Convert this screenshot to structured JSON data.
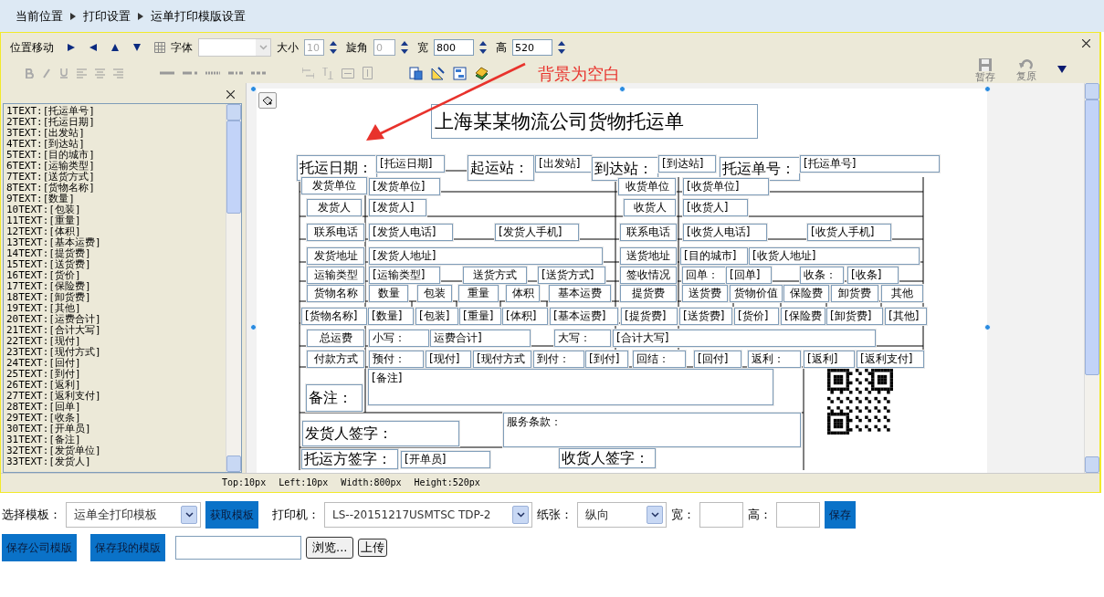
{
  "breadcrumb": [
    "当前位置",
    "打印设置",
    "运单打印模版设置"
  ],
  "toolbar": {
    "move_label": "位置移动",
    "font_label": "字体",
    "size_label": "大小",
    "size_value": "10",
    "size_disabled": true,
    "rotate_label": "旋角",
    "rotate_value": "0",
    "rotate_disabled": true,
    "width_label": "宽",
    "width_value": "800",
    "height_label": "高",
    "height_value": "520",
    "save_draft": "暂存",
    "restore": "复原",
    "actions_disabled": true
  },
  "annotation": "背景为空白",
  "field_list": [
    "1TEXT:[托运单号]",
    "2TEXT:[托运日期]",
    "3TEXT:[出发站]",
    "4TEXT:[到达站]",
    "5TEXT:[目的城市]",
    "6TEXT:[运输类型]",
    "7TEXT:[送货方式]",
    "8TEXT:[货物名称]",
    "9TEXT:[数量]",
    "10TEXT:[包装]",
    "11TEXT:[重量]",
    "12TEXT:[体积]",
    "13TEXT:[基本运费]",
    "14TEXT:[提货费]",
    "15TEXT:[送货费]",
    "16TEXT:[货价]",
    "17TEXT:[保险费]",
    "18TEXT:[卸货费]",
    "19TEXT:[其他]",
    "20TEXT:[运费合计]",
    "21TEXT:[合计大写]",
    "22TEXT:[现付]",
    "23TEXT:[现付方式]",
    "24TEXT:[回付]",
    "25TEXT:[到付]",
    "26TEXT:[返利]",
    "27TEXT:[返利支付]",
    "28TEXT:[回单]",
    "29TEXT:[收条]",
    "30TEXT:[开单员]",
    "31TEXT:[备注]",
    "32TEXT:[发货单位]",
    "33TEXT:[发货人]"
  ],
  "canvas": {
    "title": "上海某某物流公司货物托运单",
    "fields": [
      {
        "text": "托运日期：",
        "kind": "heading"
      },
      {
        "text": "[托运日期]",
        "kind": "value"
      },
      {
        "text": "起运站：",
        "kind": "heading"
      },
      {
        "text": "[出发站]",
        "kind": "value"
      },
      {
        "text": "到达站：",
        "kind": "heading"
      },
      {
        "text": "[到达站]",
        "kind": "value"
      },
      {
        "text": "托运单号：",
        "kind": "heading"
      },
      {
        "text": "[托运单号]",
        "kind": "value"
      },
      {
        "text": "发货单位",
        "kind": "label"
      },
      {
        "text": "[发货单位]",
        "kind": "value"
      },
      {
        "text": "收货单位",
        "kind": "label"
      },
      {
        "text": "[收货单位]",
        "kind": "value"
      },
      {
        "text": "发货人",
        "kind": "label"
      },
      {
        "text": "[发货人]",
        "kind": "value"
      },
      {
        "text": "收货人",
        "kind": "label"
      },
      {
        "text": "[收货人]",
        "kind": "value"
      },
      {
        "text": "联系电话",
        "kind": "label"
      },
      {
        "text": "[发货人电话]",
        "kind": "value"
      },
      {
        "text": "[发货人手机]",
        "kind": "value"
      },
      {
        "text": "联系电话",
        "kind": "label"
      },
      {
        "text": "[收货人电话]",
        "kind": "value"
      },
      {
        "text": "[收货人手机]",
        "kind": "value"
      },
      {
        "text": "发货地址",
        "kind": "label"
      },
      {
        "text": "[发货人地址]",
        "kind": "value"
      },
      {
        "text": "送货地址",
        "kind": "label"
      },
      {
        "text": "[目的城市]",
        "kind": "value"
      },
      {
        "text": "[收货人地址]",
        "kind": "value"
      },
      {
        "text": "运输类型",
        "kind": "label"
      },
      {
        "text": "[运输类型]",
        "kind": "value"
      },
      {
        "text": "送货方式",
        "kind": "label"
      },
      {
        "text": "[送货方式]",
        "kind": "value"
      },
      {
        "text": "签收情况",
        "kind": "label"
      },
      {
        "text": "回单：",
        "kind": "value"
      },
      {
        "text": "[回单]",
        "kind": "value"
      },
      {
        "text": "收条：",
        "kind": "value"
      },
      {
        "text": "[收条]",
        "kind": "value"
      },
      {
        "text": "货物名称",
        "kind": "label"
      },
      {
        "text": "数量",
        "kind": "label"
      },
      {
        "text": "包装",
        "kind": "label"
      },
      {
        "text": "重量",
        "kind": "label"
      },
      {
        "text": "体积",
        "kind": "label"
      },
      {
        "text": "基本运费",
        "kind": "label"
      },
      {
        "text": "提货费",
        "kind": "label"
      },
      {
        "text": "送货费",
        "kind": "label"
      },
      {
        "text": "货物价值",
        "kind": "label"
      },
      {
        "text": "保险费",
        "kind": "label"
      },
      {
        "text": "卸货费",
        "kind": "label"
      },
      {
        "text": "其他",
        "kind": "label"
      },
      {
        "text": "[货物名称]",
        "kind": "value"
      },
      {
        "text": "[数量]",
        "kind": "value"
      },
      {
        "text": "[包装]",
        "kind": "value"
      },
      {
        "text": "[重量]",
        "kind": "value"
      },
      {
        "text": "[体积]",
        "kind": "value"
      },
      {
        "text": "[基本运费]",
        "kind": "value"
      },
      {
        "text": "[提货费]",
        "kind": "value"
      },
      {
        "text": "[送货费]",
        "kind": "value"
      },
      {
        "text": "[货价]",
        "kind": "value"
      },
      {
        "text": "[保险费",
        "kind": "value"
      },
      {
        "text": "[卸货费]",
        "kind": "value"
      },
      {
        "text": "[其他]",
        "kind": "value"
      },
      {
        "text": "总运费",
        "kind": "label"
      },
      {
        "text": "小写：",
        "kind": "value"
      },
      {
        "text": "运费合计]",
        "kind": "value"
      },
      {
        "text": "大写：",
        "kind": "value"
      },
      {
        "text": "[合计大写]",
        "kind": "value"
      },
      {
        "text": "付款方式",
        "kind": "label"
      },
      {
        "text": "预付：",
        "kind": "value"
      },
      {
        "text": "[现付]",
        "kind": "value"
      },
      {
        "text": "[现付方式",
        "kind": "value"
      },
      {
        "text": "到付：",
        "kind": "value"
      },
      {
        "text": "[到付]",
        "kind": "value"
      },
      {
        "text": "回结：",
        "kind": "value"
      },
      {
        "text": "[回付]",
        "kind": "value"
      },
      {
        "text": "返利：",
        "kind": "value"
      },
      {
        "text": "[返利]",
        "kind": "value"
      },
      {
        "text": "[返利支付]",
        "kind": "value"
      },
      {
        "text": "[备注]",
        "kind": "area"
      },
      {
        "text": "备注：",
        "kind": "heading"
      },
      {
        "text": "发货人签字：",
        "kind": "heading"
      },
      {
        "text": "服务条款：",
        "kind": "area"
      },
      {
        "text": "托运方签字：",
        "kind": "heading"
      },
      {
        "text": "[开单员]",
        "kind": "value"
      },
      {
        "text": "收货人签字：",
        "kind": "heading"
      }
    ]
  },
  "status_bar": [
    "Top:10px",
    "Left:10px",
    "Width:800px",
    "Height:520px"
  ],
  "bottom": {
    "template_label": "选择模板：",
    "template_value": "运单全打印模板",
    "get_template": "获取模板",
    "printer_label": "打印机：",
    "printer_value": "LS--20151217USMTSC TDP-2",
    "paper_label": "纸张：",
    "paper_value": "纵向",
    "width_label": "宽：",
    "height_label": "高：",
    "save": "保存",
    "save_company": "保存公司模版",
    "save_mine": "保存我的模版",
    "browse": "浏览...",
    "upload": "上传"
  }
}
